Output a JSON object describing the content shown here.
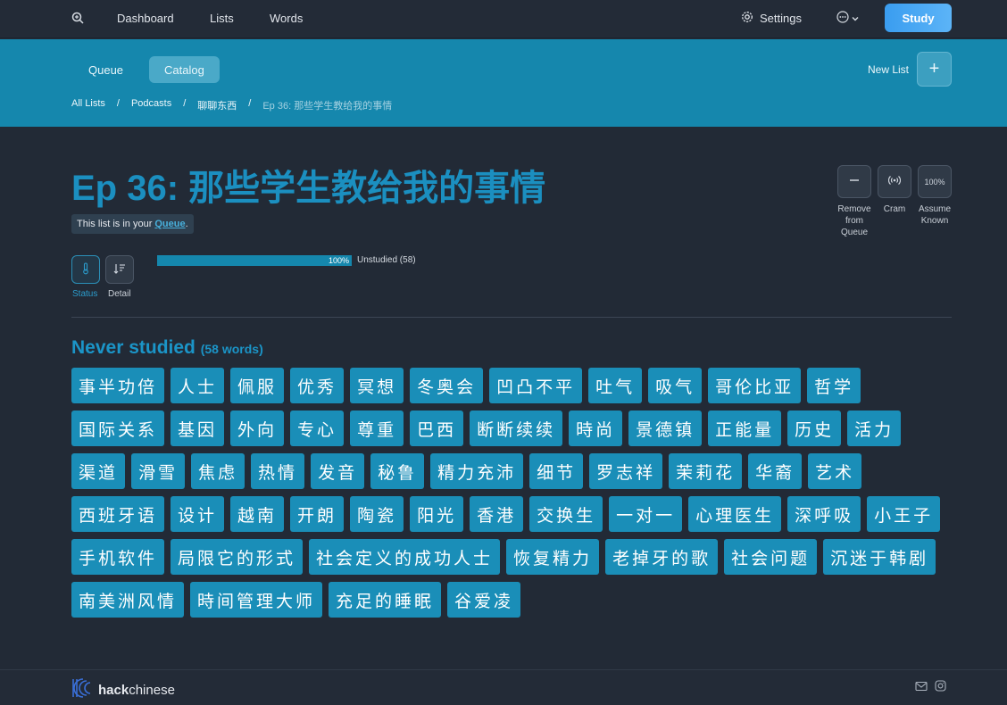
{
  "nav": {
    "links": [
      "Dashboard",
      "Lists",
      "Words"
    ],
    "settings_label": "Settings",
    "study_label": "Study",
    "icons": {
      "search": "search-icon",
      "settings": "gear-icon",
      "more": "ellipsis-circle-icon"
    }
  },
  "header": {
    "tabs": [
      {
        "label": "Queue",
        "active": false
      },
      {
        "label": "Catalog",
        "active": true
      }
    ],
    "new_list_label": "New List",
    "new_list_icon": "+",
    "breadcrumbs": [
      "All Lists",
      "Podcasts",
      "聊聊东西",
      "Ep 36: 那些学生教给我的事情"
    ],
    "separator": "/"
  },
  "main": {
    "title": "Ep 36: 那些学生教给我的事情",
    "queue_note": {
      "prefix": "This list is in your",
      "link": "Queue",
      "suffix": "."
    },
    "actions": [
      {
        "icon": "minus-icon",
        "label": "Remove from Queue"
      },
      {
        "icon": "broadcast-icon",
        "label": "Cram"
      },
      {
        "icon": "100%",
        "label": "Assume Known"
      }
    ],
    "controls": {
      "status_label": "Status",
      "detail_label": "Detail"
    },
    "progress": {
      "value": 1.0,
      "percent_label": "100%",
      "label": "Unstudied (58)"
    },
    "section": {
      "title": "Never studied",
      "count_label": "(58 words)"
    },
    "words": [
      "事半功倍",
      "人士",
      "佩服",
      "优秀",
      "冥想",
      "冬奥会",
      "凹凸不平",
      "吐气",
      "吸气",
      "哥伦比亚",
      "哲学",
      "国际关系",
      "基因",
      "外向",
      "专心",
      "尊重",
      "巴西",
      "断断续续",
      "時尚",
      "景德镇",
      "正能量",
      "历史",
      "活力",
      "渠道",
      "滑雪",
      "焦虑",
      "热情",
      "发音",
      "秘鲁",
      "精力充沛",
      "细节",
      "罗志祥",
      "茉莉花",
      "华裔",
      "艺术",
      "西班牙语",
      "设计",
      "越南",
      "开朗",
      "陶瓷",
      "阳光",
      "香港",
      "交换生",
      "一对一",
      "心理医生",
      "深呼吸",
      "小王子",
      "手机软件",
      "局限它的形式",
      "社会定义的成功人士",
      "恢复精力",
      "老掉牙的歌",
      "社会问题",
      "沉迷于韩剧",
      "南美洲风情",
      "時间管理大师",
      "充足的睡眠",
      "谷爱凌"
    ]
  },
  "footer": {
    "brand_bold": "hack",
    "brand_rest": "chinese",
    "icons": [
      "mail-icon",
      "instagram-icon"
    ]
  },
  "colors": {
    "accent": "#1587ad",
    "chip": "#1a8eb8",
    "background": "#222a36",
    "title": "#1b8fc0",
    "study_button": "#3a9df0"
  }
}
